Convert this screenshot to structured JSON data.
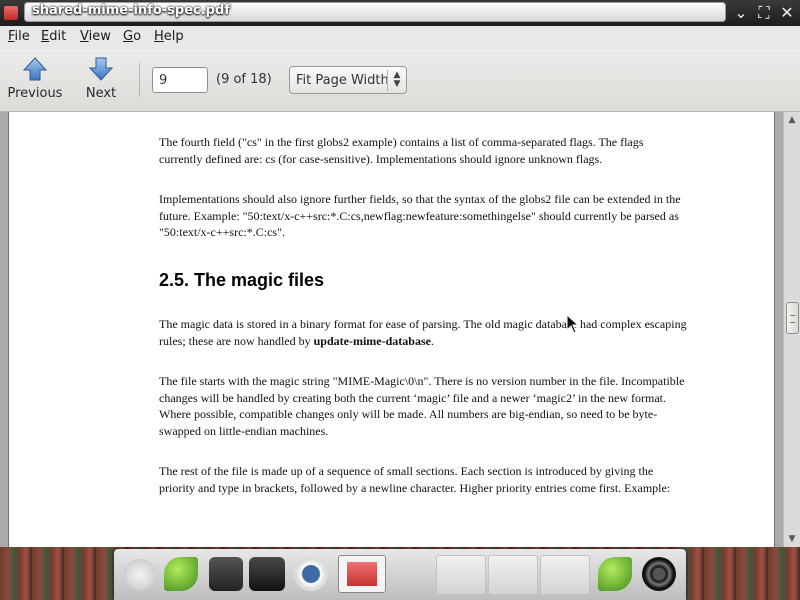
{
  "window": {
    "title": "shared-mime-info-spec.pdf",
    "controls": [
      "chevron-down-icon",
      "maximize-icon",
      "close-icon"
    ]
  },
  "menubar": {
    "file": {
      "hot": "F",
      "rest": "ile"
    },
    "edit": {
      "hot": "E",
      "rest": "dit"
    },
    "view": {
      "hot": "V",
      "rest": "iew"
    },
    "go": {
      "hot": "G",
      "rest": "o"
    },
    "help": {
      "hot": "H",
      "rest": "elp"
    }
  },
  "toolbar": {
    "previous_label": "Previous",
    "next_label": "Next",
    "page_value": "9",
    "page_count": "(9 of 18)",
    "zoom_value": "Fit Page Width"
  },
  "document": {
    "paragraph_1": "The fourth field (\"cs\" in the first globs2 example) contains a list of comma-separated flags. The flags currently defined are: cs (for case-sensitive). Implementations should ignore unknown flags.",
    "paragraph_2": "Implementations should also ignore further fields, so that the syntax of the globs2 file can be extended in the future. Example: \"50:text/x-c++src:*.C:cs,newflag:newfeature:somethingelse\" should currently be parsed as \"50:text/x-c++src:*.C:cs\".",
    "section_heading": "2.5. The magic files",
    "paragraph_3_before": "The magic data is stored in a binary format for ease of parsing. The old magic database had complex escaping rules; these are now handled by ",
    "paragraph_3_bold": "update-mime-database",
    "paragraph_3_after": ".",
    "paragraph_4": "The file starts with the magic string \"MIME-Magic\\0\\n\". There is no version number in the file. Incompatible changes will be handled by creating both the current ‘magic’ file and a newer ‘magic2’ in the new format. Where possible, compatible changes only will be made. All numbers are big-endian, so need to be byte-swapped on little-endian machines.",
    "paragraph_5": "The rest of the file is made up of a sequence of small sections. Each section is introduced by giving the priority and type in brackets, followed by a newline character. Higher priority entries come first. Example:"
  },
  "scrollbar": {
    "position_fraction": 0.47
  },
  "taskbar": {
    "items": [
      "clock-icon",
      "leaf-app-icon",
      "printer-icon",
      "terminal-icon",
      "media-player-icon",
      "pdf-viewer-icon",
      "empty-slot",
      "empty-slot",
      "empty-slot",
      "leaf-app-icon",
      "power-icon"
    ]
  }
}
